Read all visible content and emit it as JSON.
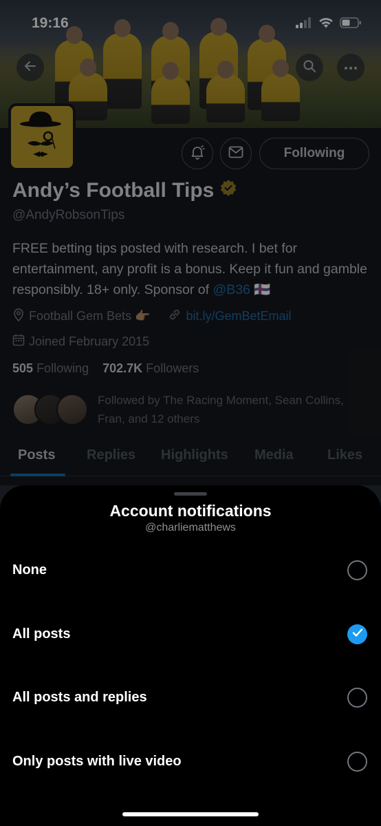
{
  "status_bar": {
    "time": "19:16"
  },
  "profile": {
    "name": "Andy’s Football Tips",
    "handle": "@AndyRobsonTips",
    "bio_text": "FREE betting tips posted with research. I bet for entertainment, any profit is a bonus. Keep it fun and gamble responsibly. 18+ only. Sponsor of ",
    "bio_mention": "@B36",
    "bio_flag": "🇫🇴",
    "location": "Football Gem Bets 👉🏽",
    "website": "bit.ly/GemBetEmail",
    "joined": "Joined February 2015",
    "following_count": "505",
    "following_label": "Following",
    "followers_count": "702.7K",
    "followers_label": "Followers",
    "followed_by": "Followed by The Racing Moment, Sean Collins, Fran, and 12 others",
    "following_button": "Following"
  },
  "tabs": [
    {
      "label": "Posts",
      "active": true
    },
    {
      "label": "Replies",
      "active": false
    },
    {
      "label": "Highlights",
      "active": false
    },
    {
      "label": "Media",
      "active": false
    },
    {
      "label": "Likes",
      "active": false
    }
  ],
  "sheet": {
    "title": "Account notifications",
    "subtitle": "@charliematthews",
    "options": [
      {
        "label": "None",
        "selected": false
      },
      {
        "label": "All posts",
        "selected": true
      },
      {
        "label": "All posts and replies",
        "selected": false
      },
      {
        "label": "Only posts with live video",
        "selected": false
      }
    ]
  },
  "icons": {
    "back": "arrow-left-icon",
    "search": "search-icon",
    "more": "more-icon",
    "notify": "bell-icon",
    "message": "envelope-icon",
    "verified": "verified-badge-icon",
    "location": "location-pin-icon",
    "link": "link-icon",
    "calendar": "calendar-icon",
    "check": "checkmark-icon"
  },
  "colors": {
    "accent": "#1d9bf0",
    "verified_gold": "#b79a2c",
    "background": "#000000"
  }
}
